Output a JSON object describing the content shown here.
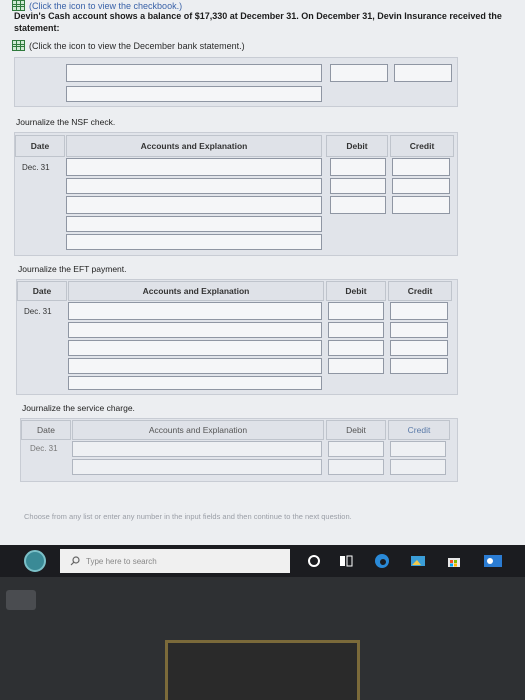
{
  "header": {
    "top_link": "(Click the icon to view the checkbook.)",
    "intro": "Devin's Cash account shows a balance of $17,330 at December 31. On December 31, Devin Insurance received the statement:",
    "bank_link": "(Click the icon to view the December bank statement.)"
  },
  "sections": {
    "nsf": {
      "title": "Journalize the NSF check.",
      "date_hdr": "Date",
      "acct_hdr": "Accounts and Explanation",
      "debit_hdr": "Debit",
      "credit_hdr": "Credit",
      "date": "Dec. 31"
    },
    "eft": {
      "title": "Journalize the EFT payment.",
      "date_hdr": "Date",
      "acct_hdr": "Accounts and Explanation",
      "debit_hdr": "Debit",
      "credit_hdr": "Credit",
      "date": "Dec. 31"
    },
    "service": {
      "title": "Journalize the service charge.",
      "date_hdr": "Date",
      "acct_hdr": "Accounts and Explanation",
      "debit_hdr": "Debit",
      "credit_hdr": "Credit",
      "date": "Dec. 31"
    }
  },
  "footer": {
    "instruction": "Choose from any list or enter any number in the input fields and then continue to the next question."
  },
  "taskbar": {
    "search_placeholder": "Type here to search"
  },
  "colors": {
    "accent": "#3a62a8",
    "panel": "#e1e4ea",
    "taskbar": "#1b1c20"
  }
}
